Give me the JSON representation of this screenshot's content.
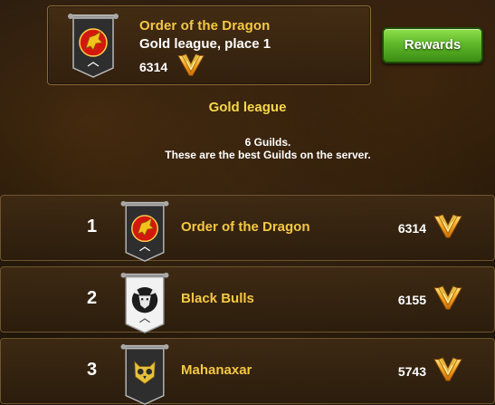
{
  "header": {
    "guild_name": "Order of the Dragon",
    "league_place": "Gold league, place 1",
    "score": "6314",
    "banner": "dragon-banner-icon"
  },
  "rewards_label": "Rewards",
  "league": {
    "title": "Gold league",
    "count_line": "6 Guilds.",
    "desc_line": "These are the best Guilds on the server."
  },
  "rows": [
    {
      "rank": "1",
      "name": "Order of the Dragon",
      "score": "6314",
      "banner": "dragon-banner-icon"
    },
    {
      "rank": "2",
      "name": "Black Bulls",
      "score": "6155",
      "banner": "bull-banner-icon"
    },
    {
      "rank": "3",
      "name": "Mahanaxar",
      "score": "5743",
      "banner": "owl-banner-icon"
    }
  ],
  "colors": {
    "gold_text": "#f5c842",
    "rewards_green": "#5fb82a",
    "panel_border": "#8a6a3a"
  }
}
